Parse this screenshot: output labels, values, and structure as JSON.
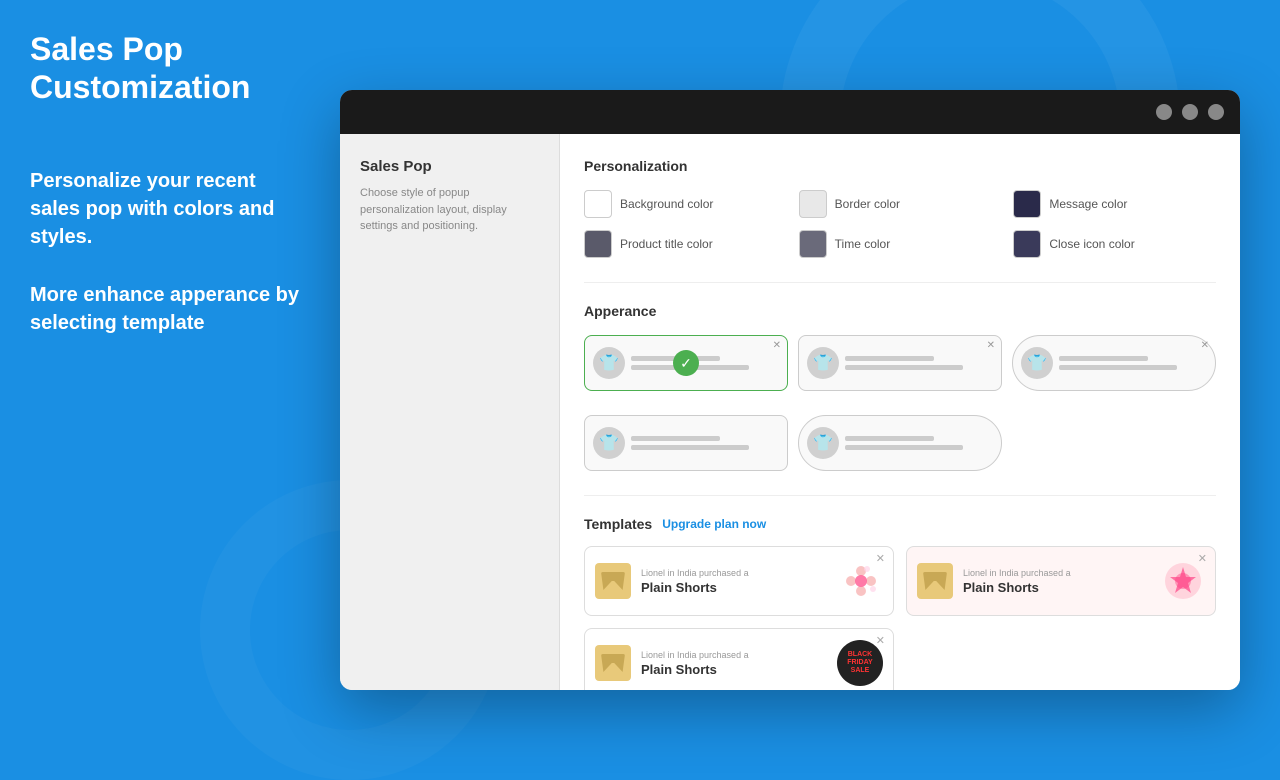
{
  "page": {
    "title": "Sales Pop Customization",
    "left_desc1": "Personalize your recent sales pop with colors and styles.",
    "left_desc2": "More enhance apperance by selecting template"
  },
  "sidebar": {
    "title": "Sales Pop",
    "description": "Choose style of popup personalization layout, display settings and positioning."
  },
  "personalization": {
    "section_title": "Personalization",
    "colors": [
      {
        "label": "Background color",
        "swatch": "#ffffff",
        "border": "#ccc"
      },
      {
        "label": "Border color",
        "swatch": "#e8e8e8",
        "border": "#ccc"
      },
      {
        "label": "Message color",
        "swatch": "#2a2a4a",
        "border": "#ccc"
      },
      {
        "label": "Product title color",
        "swatch": "#5a5a6a",
        "border": "#ccc"
      },
      {
        "label": "Time color",
        "swatch": "#6a6a7a",
        "border": "#ccc"
      },
      {
        "label": "Close icon color",
        "swatch": "#3a3a5a",
        "border": "#ccc"
      }
    ]
  },
  "appearance": {
    "section_title": "Apperance",
    "templates": [
      {
        "id": 1,
        "selected": true,
        "style": "square"
      },
      {
        "id": 2,
        "selected": false,
        "style": "square"
      },
      {
        "id": 3,
        "selected": false,
        "style": "square"
      },
      {
        "id": 4,
        "selected": false,
        "style": "square"
      },
      {
        "id": 5,
        "selected": false,
        "style": "rounded"
      }
    ]
  },
  "templates": {
    "section_title": "Templates",
    "upgrade_label": "Upgrade plan now",
    "items": [
      {
        "id": 1,
        "purchased_text": "Lionel in India purchased a",
        "name": "Plain Shorts",
        "badge_type": "flowers",
        "bg": "white"
      },
      {
        "id": 2,
        "purchased_text": "Lionel in India purchased a",
        "name": "Plain Shorts",
        "badge_type": "pink",
        "bg": "pink"
      },
      {
        "id": 3,
        "purchased_text": "Lionel in India purchased a",
        "name": "Plain Shorts",
        "badge_type": "blackfriday",
        "bg": "white"
      }
    ]
  },
  "window": {
    "btn1": "",
    "btn2": "",
    "btn3": ""
  }
}
